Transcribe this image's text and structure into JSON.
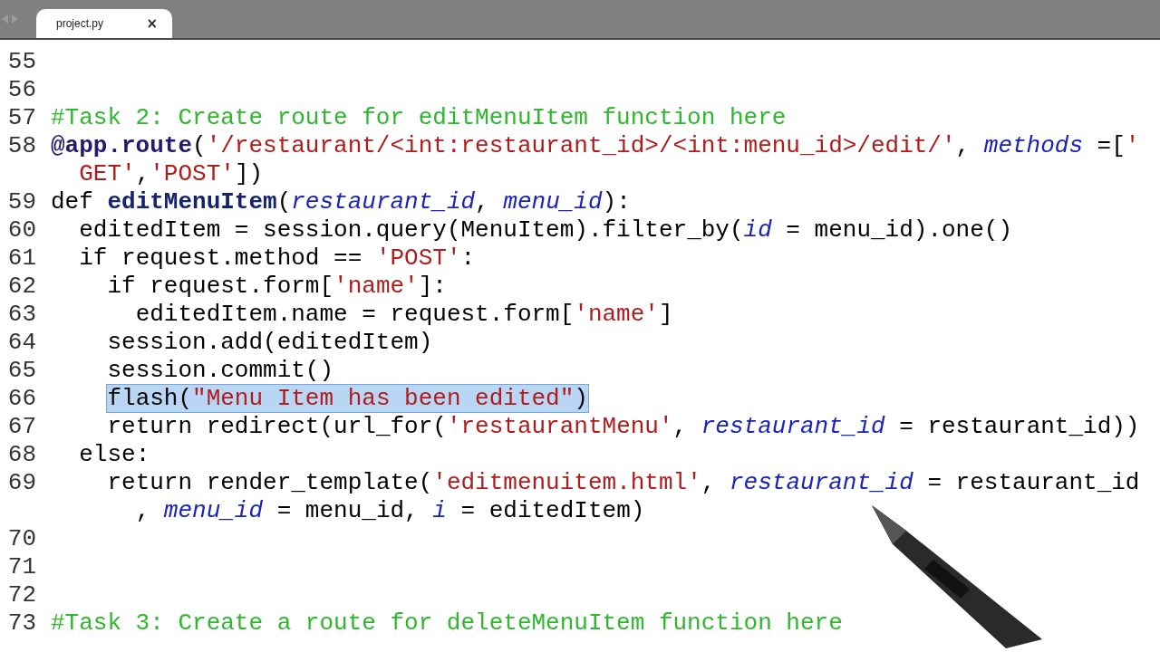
{
  "tab": {
    "title": "project.py",
    "close": "×"
  },
  "lines": [
    {
      "number": "55",
      "highlighted": false,
      "rows": [
        {
          "spans": []
        }
      ]
    },
    {
      "number": "56",
      "highlighted": false,
      "rows": [
        {
          "spans": []
        }
      ]
    },
    {
      "number": "57",
      "highlighted": false,
      "rows": [
        {
          "spans": [
            {
              "text": "#Task 2: Create route for editMenuItem function here",
              "kind": "comment"
            }
          ]
        }
      ]
    },
    {
      "number": "58",
      "highlighted": false,
      "rows": [
        {
          "spans": [
            {
              "text": "@app.route",
              "kind": "decorator"
            },
            {
              "text": "(",
              "kind": "plain"
            },
            {
              "text": "'/restaurant/<int:restaurant_id>/<int:menu_id>/edit/'",
              "kind": "string"
            },
            {
              "text": ", ",
              "kind": "plain"
            },
            {
              "text": "methods",
              "kind": "param"
            },
            {
              "text": " =[",
              "kind": "plain"
            },
            {
              "text": "'",
              "kind": "string"
            }
          ]
        },
        {
          "spans": [
            {
              "text": "  GET'",
              "kind": "string"
            },
            {
              "text": ",",
              "kind": "plain"
            },
            {
              "text": "'POST'",
              "kind": "string"
            },
            {
              "text": "])",
              "kind": "plain"
            }
          ]
        }
      ]
    },
    {
      "number": "59",
      "highlighted": false,
      "rows": [
        {
          "spans": [
            {
              "text": "def ",
              "kind": "plain"
            },
            {
              "text": "editMenuItem",
              "kind": "funcname"
            },
            {
              "text": "(",
              "kind": "plain"
            },
            {
              "text": "restaurant_id",
              "kind": "param"
            },
            {
              "text": ", ",
              "kind": "plain"
            },
            {
              "text": "menu_id",
              "kind": "param"
            },
            {
              "text": "):",
              "kind": "plain"
            }
          ]
        }
      ]
    },
    {
      "number": "60",
      "highlighted": false,
      "rows": [
        {
          "spans": [
            {
              "text": "  editedItem = session.query(MenuItem).filter_by(",
              "kind": "plain"
            },
            {
              "text": "id",
              "kind": "param"
            },
            {
              "text": " = menu_id).one()",
              "kind": "plain"
            }
          ]
        }
      ]
    },
    {
      "number": "61",
      "highlighted": false,
      "rows": [
        {
          "spans": [
            {
              "text": "  if",
              "kind": "keyword"
            },
            {
              "text": " request.method == ",
              "kind": "plain"
            },
            {
              "text": "'POST'",
              "kind": "string"
            },
            {
              "text": ":",
              "kind": "plain"
            }
          ]
        }
      ]
    },
    {
      "number": "62",
      "highlighted": false,
      "rows": [
        {
          "spans": [
            {
              "text": "    if",
              "kind": "keyword"
            },
            {
              "text": " request.form[",
              "kind": "plain"
            },
            {
              "text": "'name'",
              "kind": "string"
            },
            {
              "text": "]:",
              "kind": "plain"
            }
          ]
        }
      ]
    },
    {
      "number": "63",
      "highlighted": false,
      "rows": [
        {
          "spans": [
            {
              "text": "      editedItem.name = request.form[",
              "kind": "plain"
            },
            {
              "text": "'name'",
              "kind": "string"
            },
            {
              "text": "]",
              "kind": "plain"
            }
          ]
        }
      ]
    },
    {
      "number": "64",
      "highlighted": false,
      "rows": [
        {
          "spans": [
            {
              "text": "    session.add(editedItem)",
              "kind": "plain"
            }
          ]
        }
      ]
    },
    {
      "number": "65",
      "highlighted": false,
      "rows": [
        {
          "spans": [
            {
              "text": "    session.commit()",
              "kind": "plain"
            }
          ]
        }
      ]
    },
    {
      "number": "66",
      "highlighted": true,
      "rows": [
        {
          "spans": [
            {
              "text": "    flash(",
              "kind": "plain"
            },
            {
              "text": "\"Menu Item has been edited\"",
              "kind": "string"
            },
            {
              "text": ")",
              "kind": "plain"
            }
          ]
        }
      ]
    },
    {
      "number": "67",
      "highlighted": false,
      "rows": [
        {
          "spans": [
            {
              "text": "    return",
              "kind": "keyword"
            },
            {
              "text": " redirect(url_for(",
              "kind": "plain"
            },
            {
              "text": "'restaurantMenu'",
              "kind": "string"
            },
            {
              "text": ", ",
              "kind": "plain"
            },
            {
              "text": "restaurant_id",
              "kind": "param"
            },
            {
              "text": " = restaurant_id))",
              "kind": "plain"
            }
          ]
        }
      ]
    },
    {
      "number": "68",
      "highlighted": false,
      "rows": [
        {
          "spans": [
            {
              "text": "  else",
              "kind": "keyword"
            },
            {
              "text": ":",
              "kind": "plain"
            }
          ]
        }
      ]
    },
    {
      "number": "69",
      "highlighted": false,
      "rows": [
        {
          "spans": [
            {
              "text": "    return",
              "kind": "keyword"
            },
            {
              "text": " render_template(",
              "kind": "plain"
            },
            {
              "text": "'editmenuitem.html'",
              "kind": "string"
            },
            {
              "text": ", ",
              "kind": "plain"
            },
            {
              "text": "restaurant_id",
              "kind": "param"
            },
            {
              "text": " = restaurant_id",
              "kind": "plain"
            }
          ]
        },
        {
          "spans": [
            {
              "text": "      , ",
              "kind": "plain"
            },
            {
              "text": "menu_id",
              "kind": "param"
            },
            {
              "text": " = menu_id, ",
              "kind": "plain"
            },
            {
              "text": "i",
              "kind": "param"
            },
            {
              "text": " = editedItem)",
              "kind": "plain"
            }
          ]
        }
      ]
    },
    {
      "number": "70",
      "highlighted": false,
      "rows": [
        {
          "spans": []
        }
      ]
    },
    {
      "number": "71",
      "highlighted": false,
      "rows": [
        {
          "spans": []
        }
      ]
    },
    {
      "number": "72",
      "highlighted": false,
      "rows": [
        {
          "spans": []
        }
      ]
    },
    {
      "number": "73",
      "highlighted": false,
      "rows": [
        {
          "spans": [
            {
              "text": "#Task 3: Create a route for deleteMenuItem function here",
              "kind": "comment"
            }
          ]
        }
      ]
    }
  ]
}
